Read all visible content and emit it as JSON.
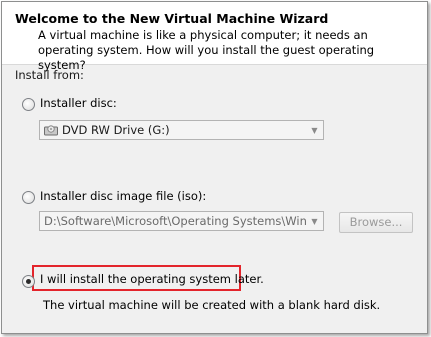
{
  "header": {
    "title": "Welcome to the New Virtual Machine Wizard",
    "subtitle": "A virtual machine is like a physical computer; it needs an operating system. How will you install the guest operating system?"
  },
  "install_from": {
    "label": "Install from:",
    "options": [
      {
        "label": "Installer disc:",
        "selected": false,
        "combo_value": "DVD RW Drive (G:)",
        "combo_icon": "optical-drive-icon"
      },
      {
        "label": "Installer disc image file (iso):",
        "selected": false,
        "combo_value": "D:\\Software\\Microsoft\\Operating Systems\\WindowsDe",
        "browse_label": "Browse..."
      },
      {
        "label": "I will install the operating system later.",
        "selected": true,
        "note": "The virtual machine will be created with a blank hard disk."
      }
    ]
  },
  "colors": {
    "highlight_border": "#e3242b",
    "panel_background": "#f0f0f0",
    "header_background": "#ffffff"
  }
}
